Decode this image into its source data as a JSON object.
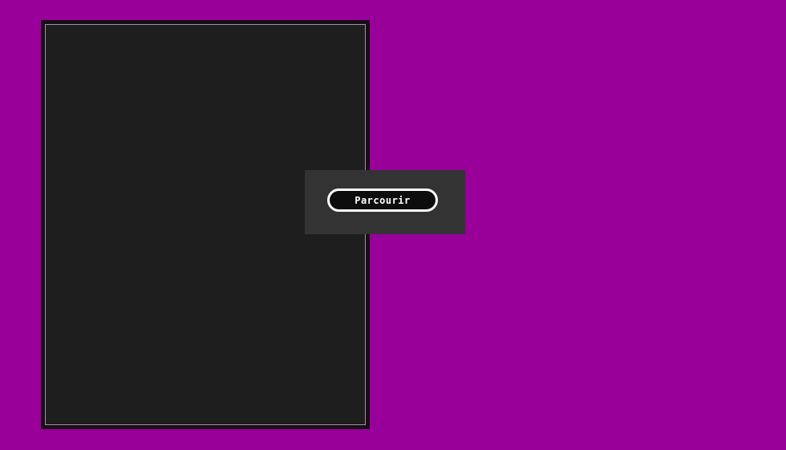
{
  "popup": {
    "browse_label": "Parcourir"
  },
  "colors": {
    "background": "#990099",
    "panel": "#1e1e1e",
    "popup": "#333333",
    "button_bg": "#0d0d0d",
    "button_border": "#ffffff"
  }
}
